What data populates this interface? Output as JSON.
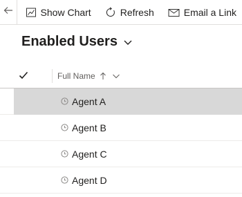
{
  "commandbar": {
    "back_icon": "arrow-left-icon",
    "show_chart": {
      "label": "Show Chart",
      "icon": "chart-icon"
    },
    "refresh": {
      "label": "Refresh",
      "icon": "refresh-icon"
    },
    "email_link": {
      "label": "Email a Link",
      "icon": "mail-icon"
    }
  },
  "view": {
    "title": "Enabled Users",
    "chevron_icon": "chevron-down-icon"
  },
  "grid": {
    "select_all_icon": "checkmark-icon",
    "columns": [
      {
        "label": "Full Name",
        "sort_icon": "arrow-up-icon",
        "menu_icon": "chevron-down-icon"
      }
    ],
    "rows": [
      {
        "name": "Agent A",
        "selected": true
      },
      {
        "name": "Agent B",
        "selected": false
      },
      {
        "name": "Agent C",
        "selected": false
      },
      {
        "name": "Agent D",
        "selected": false
      }
    ]
  },
  "colors": {
    "selected_row": "#d8d8d8",
    "text": "#201f1e",
    "muted": "#605e5c",
    "divider": "#e1dfdd"
  }
}
